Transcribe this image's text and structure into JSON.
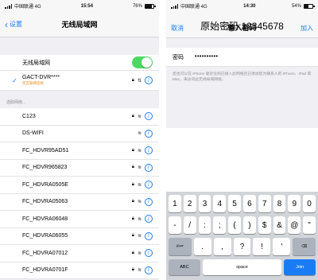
{
  "left": {
    "status": {
      "carrier": "中国联通 4G",
      "time": "15:54",
      "battery": "76%",
      "battery_level": 0.76
    },
    "nav": {
      "back_label": "设置",
      "title": "无线局域网"
    },
    "wlan": {
      "label": "无线局域网",
      "enabled": true
    },
    "connected": {
      "ssid": "GACT-DVR****",
      "subtitle": "无互联网连接"
    },
    "section_label": "选取网络...",
    "networks": [
      {
        "ssid": "C123",
        "locked": true
      },
      {
        "ssid": "DS-WIFI",
        "locked": false
      },
      {
        "ssid": "FC_HDVR95AD51",
        "locked": true
      },
      {
        "ssid": "FC_HDVR965823",
        "locked": true
      },
      {
        "ssid": "FC_HDVRA0505E",
        "locked": true
      },
      {
        "ssid": "FC_HDVRA05063",
        "locked": true
      },
      {
        "ssid": "FC_HDVRA06048",
        "locked": true
      },
      {
        "ssid": "FC_HDVRA06055",
        "locked": true
      },
      {
        "ssid": "FC_HDVRA07012",
        "locked": true
      },
      {
        "ssid": "FC_HDVRA0701F",
        "locked": true
      }
    ]
  },
  "right": {
    "status": {
      "carrier": "中国联通 4G",
      "time": "14:30",
      "battery": "54%",
      "battery_level": 0.54
    },
    "annotation": "原始密码:12345678",
    "nav": {
      "cancel_label": "取消",
      "title": "输入密码",
      "join_label": "加入"
    },
    "password": {
      "label": "密码",
      "value": "••••••••••"
    },
    "hint": "您也可以在 iPhone 靠近任何已接入此网络且已添加您为联系人的 iPhone、iPad 或 Mac，来访问此无线局域网络。",
    "keyboard": {
      "row1": [
        "1",
        "2",
        "3",
        "4",
        "5",
        "6",
        "7",
        "8",
        "9",
        "0"
      ],
      "row2": [
        "-",
        "/",
        ":",
        ";",
        "(",
        ")",
        "$",
        "&",
        "@",
        "\""
      ],
      "row3": [
        "#+=",
        ".",
        ",",
        "?",
        "!",
        "'",
        "⌫"
      ],
      "abc_label": "ABC",
      "space_label": "space",
      "join_label": "Join"
    }
  },
  "colors": {
    "accent": "#1a7cf5",
    "toggle_on": "#4cd964",
    "warning": "#f08a24"
  }
}
